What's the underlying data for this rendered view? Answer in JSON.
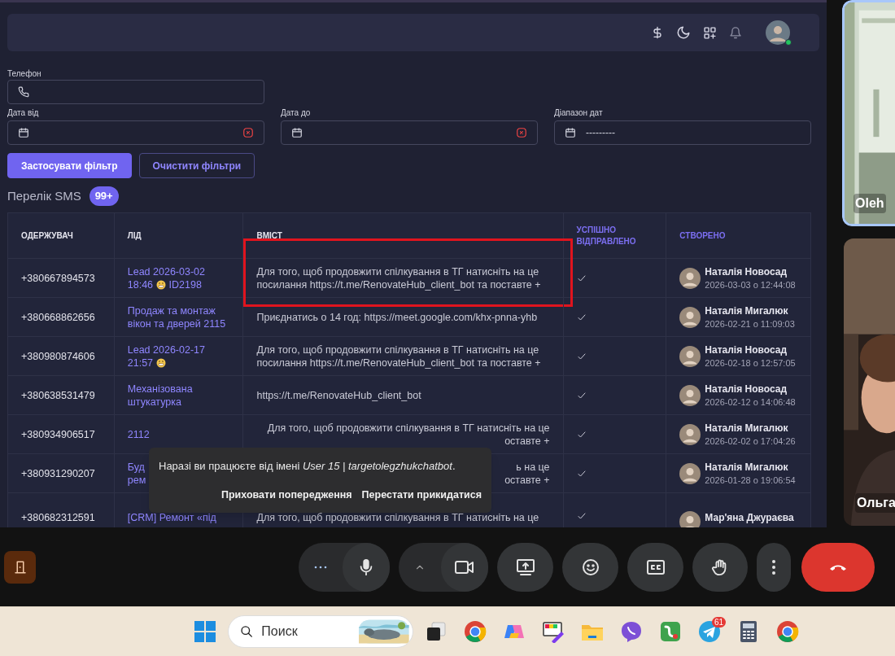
{
  "user": {
    "online": true
  },
  "filters": {
    "phone": {
      "label": "Телефон"
    },
    "date_from": {
      "label": "Дата від"
    },
    "date_to": {
      "label": "Дата до"
    },
    "range": {
      "label": "Діапазон дат",
      "value": "---------"
    }
  },
  "buttons": [
    {
      "label": "Застосувати фільтр",
      "kind": "primary"
    },
    {
      "label": "Очистити фільтри",
      "kind": "outline"
    }
  ],
  "list": {
    "title": "Перелік SMS",
    "count": "99+"
  },
  "table": {
    "columns": [
      {
        "label": "ОДЕРЖУВАЧ",
        "accent": false
      },
      {
        "label": "ЛІД",
        "accent": false
      },
      {
        "label": "ВМІСТ",
        "accent": false
      },
      {
        "label": "УСПІШНО ВІДПРАВЛЕНО",
        "accent": true
      },
      {
        "label": "СТВОРЕНО",
        "accent": true
      }
    ],
    "rows": [
      {
        "recipient": "+380667894573",
        "lead": {
          "text": "Lead 2026-03-02 18:46",
          "emoji": true,
          "suffix": "ID2198"
        },
        "content": [
          "Для того, щоб продовжити спілкування в ТГ натисніть на це",
          "посилання https://t.me/RenovateHub_client_bot та поставте +"
        ],
        "highlighted": true,
        "sent": true,
        "author": "Наталія Новосад",
        "created": "2026-03-03 о 12:44:08"
      },
      {
        "recipient": "+380668862656",
        "lead": {
          "text": "Продаж та монтаж вікон та дверей 2115"
        },
        "content": [
          "Приєднатись о 14 год: https://meet.google.com/khx-pnna-yhb"
        ],
        "sent": true,
        "author": "Наталія Мигалюк",
        "created": "2026-02-21 о 11:09:03"
      },
      {
        "recipient": "+380980874606",
        "lead": {
          "text": "Lead 2026-02-17 21:57",
          "emoji": true
        },
        "content": [
          "Для того, щоб продовжити спілкування в ТГ натисніть на це",
          "посилання https://t.me/RenovateHub_client_bot та поставте +"
        ],
        "sent": true,
        "author": "Наталія Новосад",
        "created": "2026-02-18 о 12:57:05"
      },
      {
        "recipient": "+380638531479",
        "lead": {
          "text": "Механізована штукатурка"
        },
        "content": [
          "https://t.me/RenovateHub_client_bot"
        ],
        "sent": true,
        "author": "Наталія Новосад",
        "created": "2026-02-12 о 14:06:48"
      },
      {
        "recipient": "+380934906517",
        "lead": {
          "text": "2112"
        },
        "content": [
          "Для того, щоб продовжити спілкування в ТГ натисніть на це",
          "оставте +"
        ],
        "covered": true,
        "sent": true,
        "author": "Наталія Мигалюк",
        "created": "2026-02-02 о 17:04:26"
      },
      {
        "recipient": "+380931290207",
        "lead": {
          "text": "Буд\nрем"
        },
        "content": [
          "ь на це",
          "оставте +"
        ],
        "covered": true,
        "sent": true,
        "author": "Наталія Мигалюк",
        "created": "2026-01-28 о 19:06:54"
      },
      {
        "recipient": "+380682312591",
        "lead": {
          "text": "[CRM] Ремонт «під"
        },
        "content": [
          "Для того, щоб продовжити спілкування в ТГ натисніть на це"
        ],
        "sent": true,
        "author": "Мар'яна Джураєва",
        "cut": true
      }
    ]
  },
  "toast": {
    "message": "Наразі ви працюєте від імені *User 15 | targetolegzhukchatbot*.",
    "actions": [
      "Приховати попередження",
      "Перестати прикидатися"
    ]
  },
  "participants": [
    {
      "name": "Oleh",
      "speaking": true
    },
    {
      "name": "Ольга"
    }
  ],
  "taskbar": {
    "search": {
      "placeholder": "Поиск"
    },
    "badge": "61"
  }
}
